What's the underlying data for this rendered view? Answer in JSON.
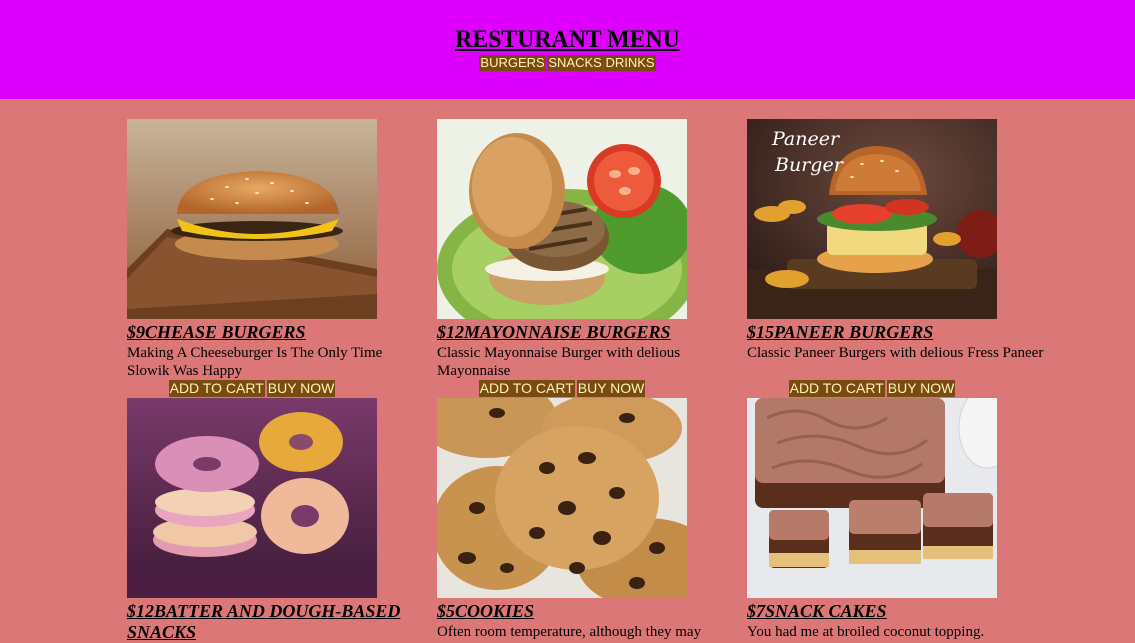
{
  "header": {
    "title": "RESTURANT MENU",
    "nav": [
      "BURGERS",
      "SNACKS",
      "DRINKS"
    ]
  },
  "menu": {
    "items": [
      {
        "price": "$9",
        "name": "CHEASE BURGERS",
        "title": "$9CHEASE BURGERS",
        "description": "Making A Cheeseburger Is The Only Time Slowik Was Happy",
        "add_label": "ADD TO CART",
        "buy_label": "BUY NOW",
        "image": "cheeseburger-image"
      },
      {
        "price": "$12",
        "name": "MAYONNAISE BURGERS",
        "title": "$12MAYONNAISE BURGERS",
        "description": "Classic Mayonnaise Burger with delious Mayonnaise",
        "add_label": "ADD TO CART",
        "buy_label": "BUY NOW",
        "image": "mayonnaise-burger-image"
      },
      {
        "price": "$15",
        "name": "PANEER BURGERS",
        "title": "$15PANEER BURGERS",
        "description": "Classic Paneer Burgers with delious Fress Paneer",
        "add_label": "ADD TO CART",
        "buy_label": "BUY NOW",
        "image": "paneer-burger-image",
        "image_text": [
          "Paneer",
          "Burger"
        ]
      },
      {
        "price": "$12",
        "name": "BATTER AND DOUGH-BASED SNACKS",
        "title": "$12BATTER AND DOUGH-BASED SNACKS",
        "description": "",
        "image": "donuts-image"
      },
      {
        "price": "$5",
        "name": "COOKIES",
        "title": "$5COOKIES",
        "description": "Often room temperature, although they may",
        "image": "cookies-image"
      },
      {
        "price": "$7",
        "name": "SNACK CAKES",
        "title": "$7SNACK CAKES",
        "description": "You had me at broiled coconut topping.",
        "image": "snack-cakes-image"
      }
    ]
  },
  "colors": {
    "header_bg": "#dd00ff",
    "page_bg": "#dc7777",
    "button_bg": "#7a4a14",
    "button_text": "#fff5b0"
  }
}
